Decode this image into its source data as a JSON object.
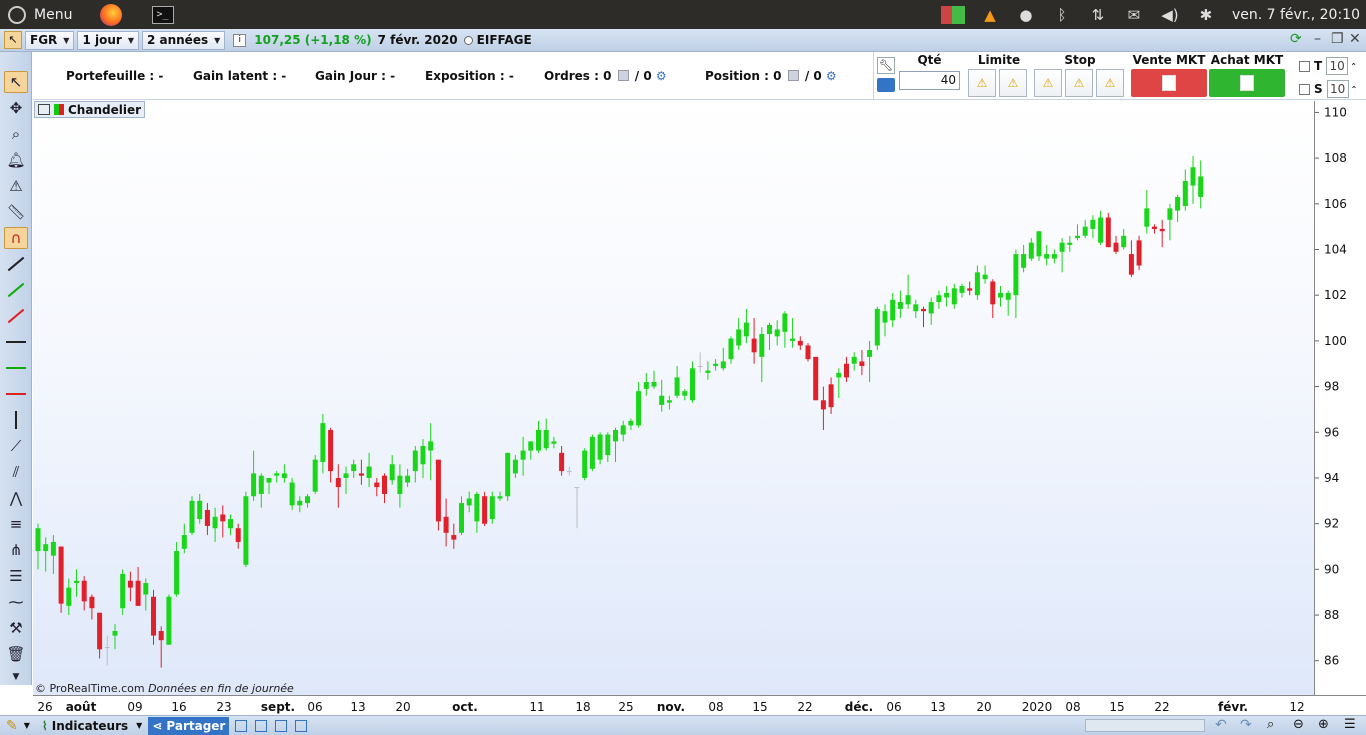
{
  "system_bar": {
    "menu_label": "Menu",
    "clock": "ven. 7 févr., 20:10"
  },
  "header": {
    "symbol": "FGR",
    "period": "1 jour",
    "range": "2 années",
    "quote": "107,25 (+1,18 %)",
    "date": "7 févr. 2020",
    "instrument": "EIFFAGE"
  },
  "position_bar": {
    "portefeuille": "Portefeuille : -",
    "gain_latent": "Gain latent : -",
    "gain_jour": "Gain Jour : -",
    "exposition": "Exposition : -",
    "ordres_label": "Ordres : 0",
    "ordres_second": "/ 0",
    "position_label": "Position : 0",
    "position_second": "/ 0"
  },
  "order_panel": {
    "qty_label": "Qté",
    "qty_value": "40",
    "limit_label": "Limite",
    "stop_label": "Stop",
    "sell_label": "Vente MKT",
    "buy_label": "Achat MKT",
    "t_label": "T",
    "s_label": "S",
    "t_value": "10",
    "s_value": "10",
    "sell_color": "#e04545",
    "buy_color": "#2fb52f"
  },
  "chart_label": "Chandelier",
  "copyright_prefix": "© ProRealTime.com",
  "copyright_suffix": "Données en fin de journée",
  "bottom_bar": {
    "indicators": "Indicateurs",
    "share": "Partager"
  },
  "chart_data": {
    "type": "candlestick",
    "title": "",
    "ylim": [
      84.5,
      110.5
    ],
    "y_ticks": [
      86,
      88,
      90,
      92,
      94,
      96,
      98,
      100,
      102,
      104,
      106,
      108,
      110
    ],
    "x_tick_labels": [
      "26",
      "août",
      "09",
      "16",
      "23",
      "sept.",
      "06",
      "13",
      "20",
      "oct.",
      "11",
      "18",
      "25",
      "nov.",
      "08",
      "15",
      "22",
      "déc.",
      "06",
      "13",
      "20",
      "2020",
      "08",
      "15",
      "22",
      "févr.",
      "12"
    ],
    "colors": {
      "up": "#19d619",
      "down": "#e0202a",
      "neutral": "#bdbdbd"
    },
    "candles": [
      {
        "o": 90.8,
        "h": 92.0,
        "l": 90.0,
        "c": 91.8
      },
      {
        "o": 90.8,
        "h": 91.4,
        "l": 89.9,
        "c": 91.1
      },
      {
        "o": 90.6,
        "h": 91.5,
        "l": 89.8,
        "c": 91.2
      },
      {
        "o": 91.0,
        "h": 91.0,
        "l": 88.1,
        "c": 88.5
      },
      {
        "o": 88.4,
        "h": 89.6,
        "l": 88.0,
        "c": 89.2
      },
      {
        "o": 89.4,
        "h": 90.0,
        "l": 88.8,
        "c": 89.5
      },
      {
        "o": 89.5,
        "h": 89.7,
        "l": 88.2,
        "c": 88.6
      },
      {
        "o": 88.8,
        "h": 88.9,
        "l": 87.8,
        "c": 88.3
      },
      {
        "o": 88.1,
        "h": 88.1,
        "l": 86.1,
        "c": 86.5
      },
      {
        "o": 86.6,
        "h": 87.1,
        "l": 85.8,
        "c": 86.6
      },
      {
        "o": 87.1,
        "h": 87.6,
        "l": 86.5,
        "c": 87.3
      },
      {
        "o": 88.3,
        "h": 90.0,
        "l": 88.0,
        "c": 89.8
      },
      {
        "o": 89.5,
        "h": 89.9,
        "l": 88.6,
        "c": 89.2
      },
      {
        "o": 89.5,
        "h": 90.1,
        "l": 88.6,
        "c": 88.4
      },
      {
        "o": 88.9,
        "h": 89.6,
        "l": 88.2,
        "c": 89.4
      },
      {
        "o": 88.8,
        "h": 89.1,
        "l": 86.7,
        "c": 87.1
      },
      {
        "o": 87.3,
        "h": 87.5,
        "l": 85.7,
        "c": 86.9
      },
      {
        "o": 86.7,
        "h": 88.9,
        "l": 86.7,
        "c": 88.8
      },
      {
        "o": 88.9,
        "h": 91.2,
        "l": 88.8,
        "c": 90.8
      },
      {
        "o": 90.9,
        "h": 92.0,
        "l": 90.7,
        "c": 91.5
      },
      {
        "o": 91.6,
        "h": 93.2,
        "l": 91.5,
        "c": 93.0
      },
      {
        "o": 92.2,
        "h": 93.3,
        "l": 92.0,
        "c": 93.0
      },
      {
        "o": 92.6,
        "h": 92.9,
        "l": 91.5,
        "c": 91.9
      },
      {
        "o": 91.8,
        "h": 92.7,
        "l": 91.2,
        "c": 92.3
      },
      {
        "o": 92.4,
        "h": 92.8,
        "l": 91.4,
        "c": 92.1
      },
      {
        "o": 91.8,
        "h": 92.4,
        "l": 91.5,
        "c": 92.2
      },
      {
        "o": 91.8,
        "h": 92.0,
        "l": 90.9,
        "c": 91.2
      },
      {
        "o": 90.2,
        "h": 93.4,
        "l": 90.1,
        "c": 93.2
      },
      {
        "o": 93.2,
        "h": 95.2,
        "l": 93.0,
        "c": 94.2
      },
      {
        "o": 93.3,
        "h": 94.2,
        "l": 92.7,
        "c": 94.1
      },
      {
        "o": 93.8,
        "h": 94.0,
        "l": 93.3,
        "c": 94.0
      },
      {
        "o": 94.1,
        "h": 94.3,
        "l": 93.8,
        "c": 94.2
      },
      {
        "o": 94.0,
        "h": 94.6,
        "l": 93.8,
        "c": 94.2
      },
      {
        "o": 92.8,
        "h": 94.0,
        "l": 92.6,
        "c": 93.8
      },
      {
        "o": 92.8,
        "h": 93.2,
        "l": 92.5,
        "c": 93.0
      },
      {
        "o": 92.9,
        "h": 93.3,
        "l": 92.7,
        "c": 93.2
      },
      {
        "o": 93.4,
        "h": 95.0,
        "l": 93.3,
        "c": 94.8
      },
      {
        "o": 94.7,
        "h": 96.8,
        "l": 94.2,
        "c": 96.4
      },
      {
        "o": 96.1,
        "h": 96.2,
        "l": 93.8,
        "c": 94.3
      },
      {
        "o": 94.0,
        "h": 94.6,
        "l": 92.7,
        "c": 93.6
      },
      {
        "o": 94.0,
        "h": 94.5,
        "l": 93.3,
        "c": 94.2
      },
      {
        "o": 94.3,
        "h": 94.8,
        "l": 94.0,
        "c": 94.6
      },
      {
        "o": 94.2,
        "h": 94.8,
        "l": 93.7,
        "c": 94.1
      },
      {
        "o": 94.0,
        "h": 95.1,
        "l": 93.6,
        "c": 94.5
      },
      {
        "o": 93.8,
        "h": 94.0,
        "l": 93.2,
        "c": 93.6
      },
      {
        "o": 94.1,
        "h": 94.2,
        "l": 92.9,
        "c": 93.3
      },
      {
        "o": 93.9,
        "h": 95.0,
        "l": 93.7,
        "c": 94.6
      },
      {
        "o": 93.3,
        "h": 94.6,
        "l": 92.7,
        "c": 94.1
      },
      {
        "o": 93.8,
        "h": 94.4,
        "l": 93.6,
        "c": 94.1
      },
      {
        "o": 94.3,
        "h": 95.4,
        "l": 93.8,
        "c": 95.2
      },
      {
        "o": 94.6,
        "h": 95.7,
        "l": 94.0,
        "c": 95.4
      },
      {
        "o": 95.2,
        "h": 96.4,
        "l": 93.9,
        "c": 95.6
      },
      {
        "o": 94.8,
        "h": 94.8,
        "l": 91.7,
        "c": 92.1
      },
      {
        "o": 92.3,
        "h": 93.1,
        "l": 91.0,
        "c": 91.6
      },
      {
        "o": 91.5,
        "h": 92.0,
        "l": 90.9,
        "c": 91.3
      },
      {
        "o": 91.6,
        "h": 93.2,
        "l": 91.5,
        "c": 92.9
      },
      {
        "o": 92.8,
        "h": 93.4,
        "l": 92.5,
        "c": 93.1
      },
      {
        "o": 92.1,
        "h": 93.4,
        "l": 91.6,
        "c": 93.3
      },
      {
        "o": 93.2,
        "h": 93.4,
        "l": 91.9,
        "c": 92.0
      },
      {
        "o": 92.2,
        "h": 93.4,
        "l": 92.0,
        "c": 93.2
      },
      {
        "o": 93.1,
        "h": 93.4,
        "l": 93.0,
        "c": 93.2
      },
      {
        "o": 93.2,
        "h": 95.1,
        "l": 93.0,
        "c": 95.1
      },
      {
        "o": 94.2,
        "h": 95.0,
        "l": 94.0,
        "c": 94.8
      },
      {
        "o": 94.8,
        "h": 95.8,
        "l": 94.1,
        "c": 95.2
      },
      {
        "o": 95.2,
        "h": 95.6,
        "l": 94.8,
        "c": 95.6
      },
      {
        "o": 95.2,
        "h": 96.5,
        "l": 95.1,
        "c": 96.1
      },
      {
        "o": 95.3,
        "h": 96.6,
        "l": 95.2,
        "c": 96.1
      },
      {
        "o": 95.5,
        "h": 95.8,
        "l": 95.3,
        "c": 95.6
      },
      {
        "o": 95.1,
        "h": 95.4,
        "l": 94.1,
        "c": 94.3
      },
      {
        "o": 94.3,
        "h": 94.5,
        "l": 94.1,
        "c": 94.3
      },
      {
        "o": 93.6,
        "h": 93.6,
        "l": 91.8,
        "c": 93.6
      },
      {
        "o": 94.0,
        "h": 95.3,
        "l": 93.9,
        "c": 95.2
      },
      {
        "o": 94.4,
        "h": 95.9,
        "l": 94.3,
        "c": 95.8
      },
      {
        "o": 94.8,
        "h": 96.0,
        "l": 94.6,
        "c": 95.9
      },
      {
        "o": 95.0,
        "h": 96.0,
        "l": 94.7,
        "c": 95.9
      },
      {
        "o": 95.6,
        "h": 96.2,
        "l": 94.7,
        "c": 96.1
      },
      {
        "o": 95.9,
        "h": 96.5,
        "l": 95.6,
        "c": 96.3
      },
      {
        "o": 96.3,
        "h": 96.6,
        "l": 96.1,
        "c": 96.5
      },
      {
        "o": 96.3,
        "h": 98.2,
        "l": 96.2,
        "c": 97.8
      },
      {
        "o": 97.9,
        "h": 98.6,
        "l": 97.6,
        "c": 98.2
      },
      {
        "o": 98.0,
        "h": 98.7,
        "l": 97.9,
        "c": 98.2
      },
      {
        "o": 97.2,
        "h": 98.3,
        "l": 96.9,
        "c": 97.6
      },
      {
        "o": 97.3,
        "h": 97.6,
        "l": 97.0,
        "c": 97.4
      },
      {
        "o": 97.6,
        "h": 98.9,
        "l": 97.5,
        "c": 98.4
      },
      {
        "o": 97.6,
        "h": 97.9,
        "l": 97.4,
        "c": 97.8
      },
      {
        "o": 97.4,
        "h": 99.1,
        "l": 97.3,
        "c": 98.8
      },
      {
        "o": 98.9,
        "h": 99.5,
        "l": 98.6,
        "c": 98.9
      },
      {
        "o": 98.6,
        "h": 99.1,
        "l": 98.3,
        "c": 98.7
      },
      {
        "o": 98.9,
        "h": 99.2,
        "l": 98.7,
        "c": 99.0
      },
      {
        "o": 98.8,
        "h": 99.7,
        "l": 98.7,
        "c": 99.1
      },
      {
        "o": 99.2,
        "h": 100.2,
        "l": 99.0,
        "c": 100.1
      },
      {
        "o": 99.8,
        "h": 101.0,
        "l": 99.6,
        "c": 100.5
      },
      {
        "o": 100.2,
        "h": 101.4,
        "l": 99.9,
        "c": 100.8
      },
      {
        "o": 100.1,
        "h": 101.0,
        "l": 99.0,
        "c": 99.5
      },
      {
        "o": 99.3,
        "h": 100.6,
        "l": 98.2,
        "c": 100.3
      },
      {
        "o": 100.3,
        "h": 100.8,
        "l": 99.6,
        "c": 100.7
      },
      {
        "o": 100.2,
        "h": 100.9,
        "l": 99.8,
        "c": 100.5
      },
      {
        "o": 100.4,
        "h": 101.3,
        "l": 99.7,
        "c": 101.2
      },
      {
        "o": 100.0,
        "h": 101.0,
        "l": 99.7,
        "c": 100.1
      },
      {
        "o": 100.0,
        "h": 100.2,
        "l": 99.6,
        "c": 99.8
      },
      {
        "o": 99.8,
        "h": 99.9,
        "l": 99.1,
        "c": 99.2
      },
      {
        "o": 99.3,
        "h": 99.3,
        "l": 97.6,
        "c": 97.4
      },
      {
        "o": 97.4,
        "h": 98.0,
        "l": 96.1,
        "c": 97.0
      },
      {
        "o": 98.1,
        "h": 98.4,
        "l": 96.8,
        "c": 97.1
      },
      {
        "o": 98.4,
        "h": 98.8,
        "l": 97.5,
        "c": 98.6
      },
      {
        "o": 99.0,
        "h": 99.3,
        "l": 98.2,
        "c": 98.4
      },
      {
        "o": 99.0,
        "h": 99.5,
        "l": 98.7,
        "c": 99.3
      },
      {
        "o": 99.1,
        "h": 99.6,
        "l": 98.5,
        "c": 98.9
      },
      {
        "o": 99.3,
        "h": 100.0,
        "l": 98.2,
        "c": 99.6
      },
      {
        "o": 99.8,
        "h": 101.5,
        "l": 99.6,
        "c": 101.4
      },
      {
        "o": 100.8,
        "h": 101.6,
        "l": 100.2,
        "c": 101.3
      },
      {
        "o": 100.9,
        "h": 102.1,
        "l": 100.6,
        "c": 101.8
      },
      {
        "o": 101.4,
        "h": 102.2,
        "l": 101.0,
        "c": 101.7
      },
      {
        "o": 101.6,
        "h": 102.9,
        "l": 101.4,
        "c": 102.0
      },
      {
        "o": 101.3,
        "h": 101.8,
        "l": 101.0,
        "c": 101.6
      },
      {
        "o": 101.4,
        "h": 101.5,
        "l": 100.6,
        "c": 101.3
      },
      {
        "o": 101.2,
        "h": 101.9,
        "l": 100.7,
        "c": 101.7
      },
      {
        "o": 101.7,
        "h": 102.2,
        "l": 101.4,
        "c": 102.0
      },
      {
        "o": 101.9,
        "h": 102.4,
        "l": 101.5,
        "c": 102.1
      },
      {
        "o": 101.6,
        "h": 102.5,
        "l": 101.4,
        "c": 102.3
      },
      {
        "o": 102.1,
        "h": 102.5,
        "l": 101.9,
        "c": 102.4
      },
      {
        "o": 102.3,
        "h": 102.6,
        "l": 102.0,
        "c": 102.2
      },
      {
        "o": 102.0,
        "h": 103.3,
        "l": 101.8,
        "c": 103.0
      },
      {
        "o": 102.7,
        "h": 103.3,
        "l": 102.5,
        "c": 102.9
      },
      {
        "o": 102.6,
        "h": 102.7,
        "l": 101.0,
        "c": 101.6
      },
      {
        "o": 101.9,
        "h": 102.4,
        "l": 101.5,
        "c": 102.1
      },
      {
        "o": 101.8,
        "h": 102.2,
        "l": 101.1,
        "c": 102.1
      },
      {
        "o": 102.0,
        "h": 104.0,
        "l": 101.0,
        "c": 103.8
      },
      {
        "o": 103.2,
        "h": 104.2,
        "l": 103.0,
        "c": 103.8
      },
      {
        "o": 103.6,
        "h": 104.5,
        "l": 103.5,
        "c": 104.3
      },
      {
        "o": 103.7,
        "h": 104.8,
        "l": 103.5,
        "c": 104.8
      },
      {
        "o": 103.6,
        "h": 104.2,
        "l": 103.3,
        "c": 103.8
      },
      {
        "o": 103.6,
        "h": 104.0,
        "l": 103.4,
        "c": 103.8
      },
      {
        "o": 103.9,
        "h": 104.5,
        "l": 103.0,
        "c": 104.3
      },
      {
        "o": 104.2,
        "h": 104.6,
        "l": 103.9,
        "c": 104.3
      },
      {
        "o": 104.5,
        "h": 105.1,
        "l": 104.4,
        "c": 104.6
      },
      {
        "o": 104.6,
        "h": 105.3,
        "l": 104.5,
        "c": 105.0
      },
      {
        "o": 104.9,
        "h": 105.5,
        "l": 104.5,
        "c": 105.3
      },
      {
        "o": 104.3,
        "h": 105.7,
        "l": 104.2,
        "c": 105.4
      },
      {
        "o": 105.4,
        "h": 105.6,
        "l": 104.2,
        "c": 104.1
      },
      {
        "o": 104.3,
        "h": 104.6,
        "l": 103.8,
        "c": 103.9
      },
      {
        "o": 104.1,
        "h": 104.9,
        "l": 104.0,
        "c": 104.6
      },
      {
        "o": 103.8,
        "h": 104.4,
        "l": 102.8,
        "c": 102.9
      },
      {
        "o": 104.4,
        "h": 104.6,
        "l": 103.1,
        "c": 103.3
      },
      {
        "o": 105.0,
        "h": 106.6,
        "l": 104.7,
        "c": 105.8
      },
      {
        "o": 105.0,
        "h": 105.1,
        "l": 104.7,
        "c": 104.9
      },
      {
        "o": 104.9,
        "h": 105.3,
        "l": 104.1,
        "c": 104.8
      },
      {
        "o": 105.3,
        "h": 106.0,
        "l": 104.4,
        "c": 105.8
      },
      {
        "o": 105.7,
        "h": 106.4,
        "l": 105.2,
        "c": 106.3
      },
      {
        "o": 105.9,
        "h": 107.5,
        "l": 105.7,
        "c": 107.0
      },
      {
        "o": 106.8,
        "h": 108.1,
        "l": 106.0,
        "c": 107.6
      },
      {
        "o": 106.3,
        "h": 107.9,
        "l": 105.8,
        "c": 107.2
      }
    ]
  }
}
